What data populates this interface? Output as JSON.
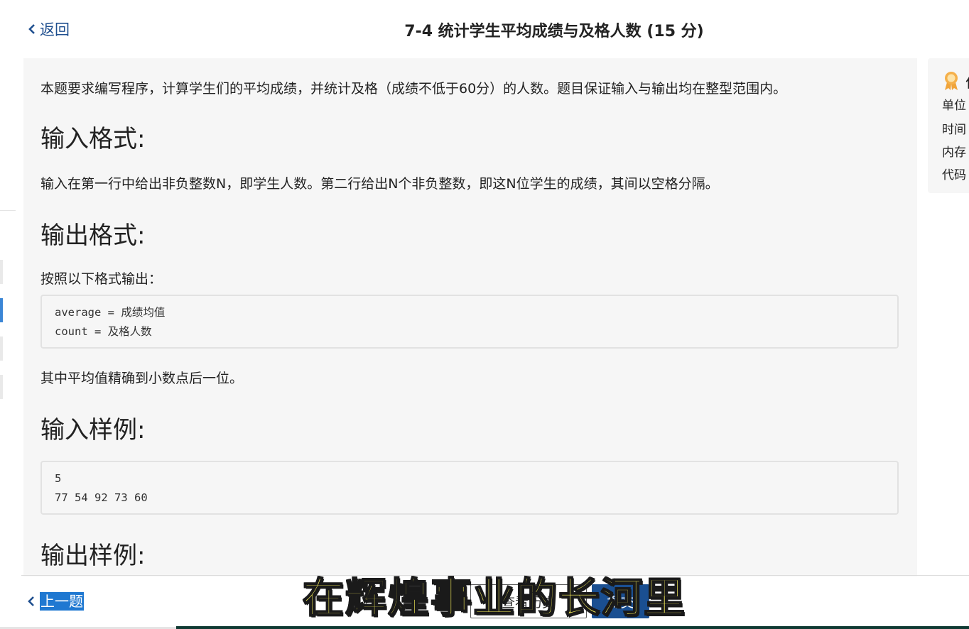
{
  "header": {
    "back_label": "返回",
    "title": "7-4 统计学生平均成绩与及格人数 (15 分)"
  },
  "problem": {
    "intro": "本题要求编写程序，计算学生们的平均成绩，并统计及格（成绩不低于60分）的人数。题目保证输入与输出均在整型范围内。",
    "input_heading": "输入格式:",
    "input_text": "输入在第一行中给出非负整数N，即学生人数。第二行给出N个非负整数，即这N位学生的成绩，其间以空格分隔。",
    "output_heading": "输出格式:",
    "output_text": "按照以下格式输出：",
    "output_format_lines": [
      "average = 成绩均值",
      "count = 及格人数"
    ],
    "output_note": "其中平均值精确到小数点后一位。",
    "sample_input_heading": "输入样例:",
    "sample_input_lines": [
      "5",
      "77 54 92 73 60"
    ],
    "sample_output_heading": "输出样例:"
  },
  "info_panel": {
    "medal_icon": "medal-icon",
    "title_fragment": "作",
    "rows": [
      "单位",
      "时间",
      "内存",
      "代码"
    ]
  },
  "footer": {
    "prev_label": "上一题",
    "view_button_label": "查看历史",
    "submit_label": "提交"
  },
  "overlay": {
    "subtitle": "在辉煌事业的长河里"
  },
  "colors": {
    "accent": "#1f78d1",
    "submit": "#1a4f91",
    "panel_bg": "#f6f6f6",
    "subtitle": "#f7ee5a"
  }
}
